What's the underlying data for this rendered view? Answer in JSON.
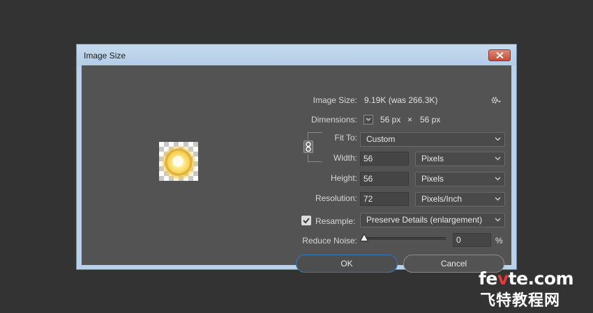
{
  "window": {
    "title": "Image Size"
  },
  "image_size": {
    "label": "Image Size:",
    "value": "9.19K (was 266.3K)"
  },
  "dimensions": {
    "label": "Dimensions:",
    "width": "56 px",
    "times": "×",
    "height": "56 px"
  },
  "fit_to": {
    "label": "Fit To:",
    "value": "Custom"
  },
  "width": {
    "label": "Width:",
    "value": "56",
    "unit": "Pixels"
  },
  "height": {
    "label": "Height:",
    "value": "56",
    "unit": "Pixels"
  },
  "resolution": {
    "label": "Resolution:",
    "value": "72",
    "unit": "Pixels/Inch"
  },
  "resample": {
    "label": "Resample:",
    "checked": true,
    "value": "Preserve Details (enlargement)"
  },
  "reduce_noise": {
    "label": "Reduce Noise:",
    "value": "0",
    "unit": "%",
    "level": 0
  },
  "buttons": {
    "ok": "OK",
    "cancel": "Cancel"
  },
  "watermark": {
    "line1_pre": "fe",
    "line1_accent": "v",
    "line1_post": "te.com",
    "line2": "飞特教程网"
  },
  "colors": {
    "ok_border": "#2f79c8",
    "client_bg": "#535353",
    "page_bg": "#333333"
  }
}
